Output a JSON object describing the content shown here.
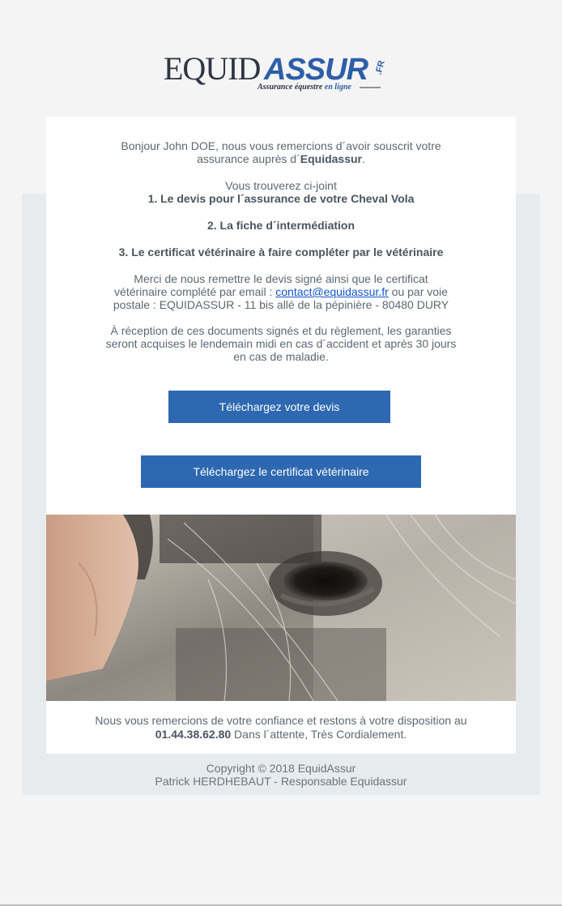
{
  "logo": {
    "word_left": "EQUID",
    "word_right": "ASSUR",
    "suffix": ".FR",
    "tagline_prefix": "Assurance équestre ",
    "tagline_emph": "en ligne"
  },
  "intro": {
    "greeting": "Bonjour John DOE, nous vous remercions d´avoir souscrit votre assurance auprès d´",
    "brand": "Equidassur",
    "end": "."
  },
  "attachments": {
    "lead": "Vous trouverez ci-joint",
    "items": [
      "1. Le devis pour l´assurance de votre Cheval Vola",
      "2. La fiche d´intermédiation",
      "3. Le certificat vétérinaire à faire compléter par le vétérinaire"
    ]
  },
  "return_info": {
    "text_before": "Merci de nous remettre le devis signé ainsi que le certificat vétérinaire complété par email : ",
    "email": "contact@equidassur.fr",
    "text_after": " ou par voie postale : EQUIDASSUR - 11 bis allé de la pépinière - 80480 DURY"
  },
  "guarantee": "À réception de ces documents signés et du règlement, les garanties seront acquises le lendemain midi en cas d´accident et après 30 jours en cas de maladie.",
  "buttons": {
    "devis": "Téléchargez votre devis",
    "certificat": "Téléchargez le certificat vétérinaire"
  },
  "footer": {
    "thanks": "Nous vous remercions de votre confiance et restons à votre disposition au",
    "phone": "01.44.38.62.80",
    "closing": " Dans l´attente, Très Cordialement."
  },
  "copyright": {
    "line1": "Copyright © 2018 EquidAssur",
    "line2": "Patrick HERDHEBAUT - Responsable Equidassur"
  },
  "colors": {
    "button": "#2d68b0",
    "brand_blue": "#2d5ea8",
    "brand_dark": "#2f3540",
    "link": "#1155cc"
  }
}
